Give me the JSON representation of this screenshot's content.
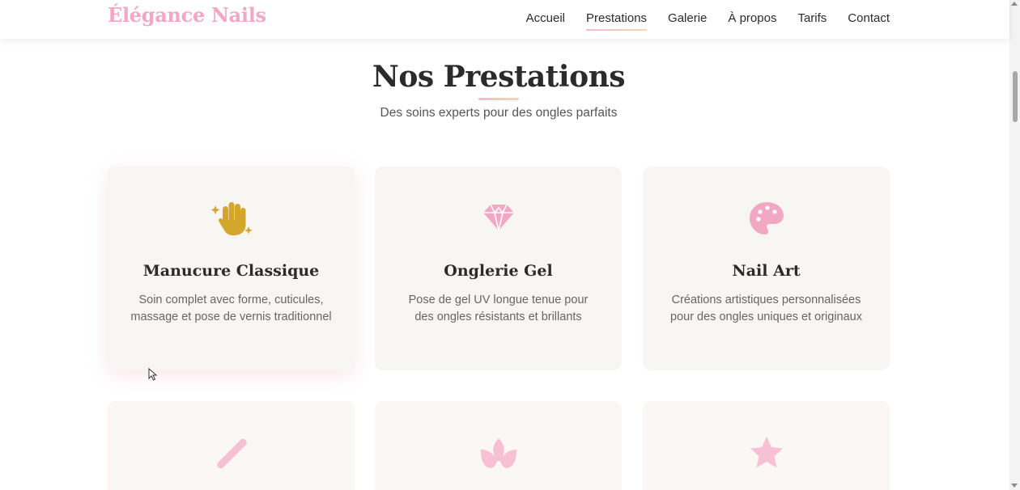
{
  "header": {
    "logo": "Élégance Nails",
    "nav": [
      {
        "label": "Accueil",
        "active": false
      },
      {
        "label": "Prestations",
        "active": true
      },
      {
        "label": "Galerie",
        "active": false
      },
      {
        "label": "À propos",
        "active": false
      },
      {
        "label": "Tarifs",
        "active": false
      },
      {
        "label": "Contact",
        "active": false
      }
    ]
  },
  "section": {
    "title": "Nos Prestations",
    "subtitle": "Des soins experts pour des ongles parfaits"
  },
  "services": [
    {
      "icon": "sparkle-hand-icon",
      "title": "Manucure Classique",
      "description": "Soin complet avec forme, cuticules, massage et pose de vernis traditionnel",
      "icon_color": "#d4a72c"
    },
    {
      "icon": "gem-icon",
      "title": "Onglerie Gel",
      "description": "Pose de gel UV longue tenue pour des ongles résistants et brillants",
      "icon_color": "#f2a7c3"
    },
    {
      "icon": "palette-icon",
      "title": "Nail Art",
      "description": "Créations artistiques personnalisées pour des ongles uniques et originaux",
      "icon_color": "#f2a7c3"
    },
    {
      "icon": "nail-file-icon",
      "icon_color": "#f7c0d4"
    },
    {
      "icon": "lotus-icon",
      "icon_color": "#f7c0d4"
    },
    {
      "icon": "star-icon",
      "icon_color": "#f7c0d4"
    }
  ],
  "colors": {
    "accent_pink": "#f2a7c3",
    "accent_gold": "#d4a72c",
    "card_bg": "#f8f6f2"
  }
}
